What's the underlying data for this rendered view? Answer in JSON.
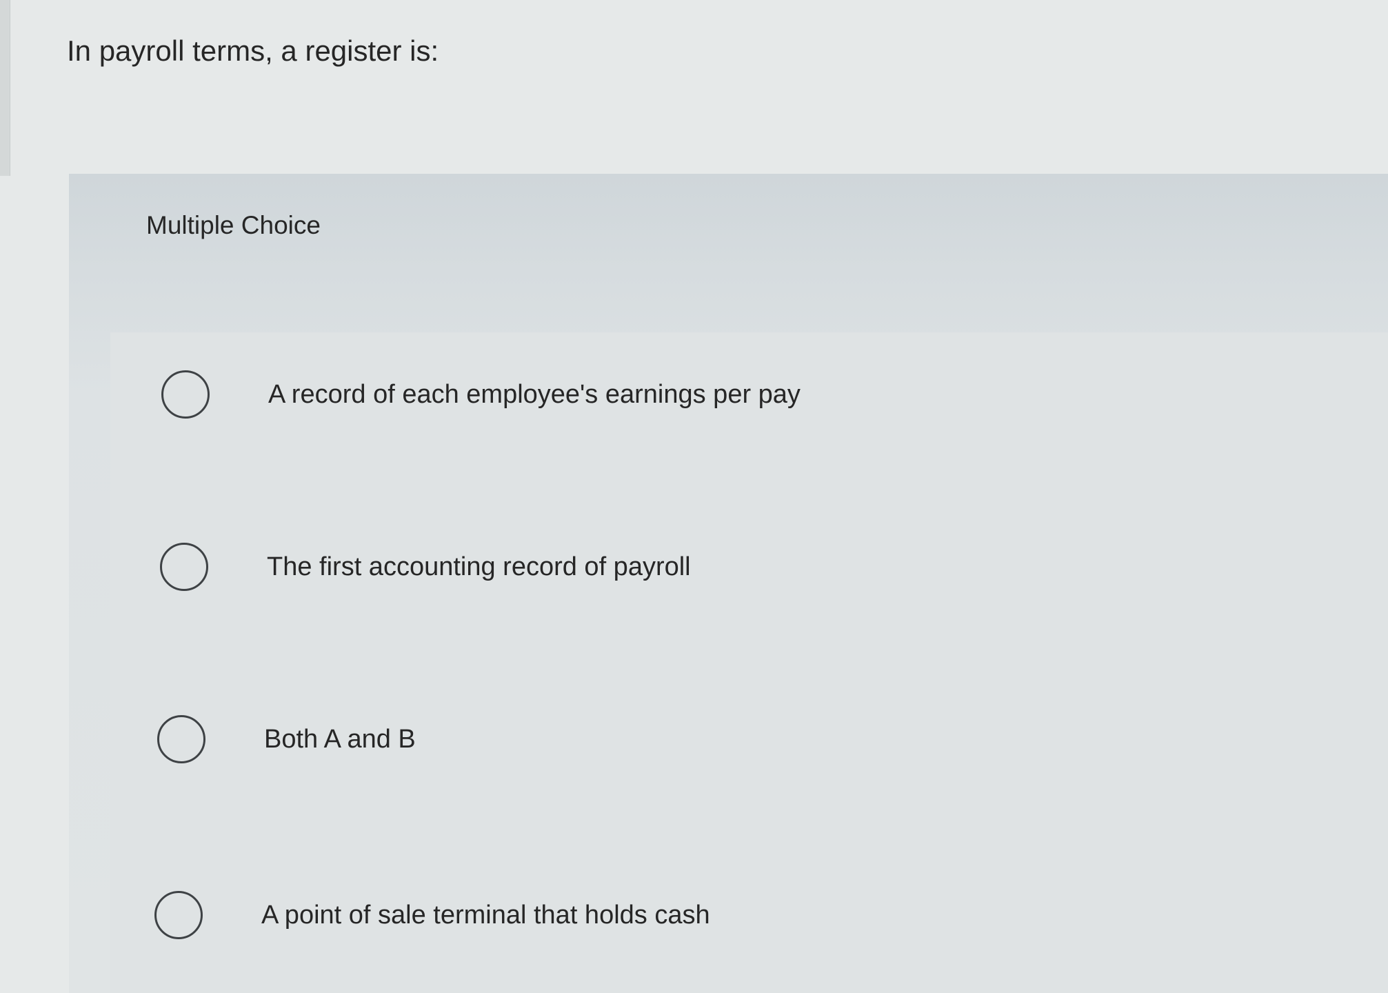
{
  "question": {
    "text": "In payroll terms, a register is:"
  },
  "choice_panel": {
    "header": "Multiple Choice",
    "options": [
      {
        "label": "A record of each employee's earnings per pay",
        "selected": false
      },
      {
        "label": "The first accounting record of payroll",
        "selected": false
      },
      {
        "label": "Both A and B",
        "selected": false
      },
      {
        "label": "A point of sale terminal that holds cash",
        "selected": false
      }
    ]
  }
}
